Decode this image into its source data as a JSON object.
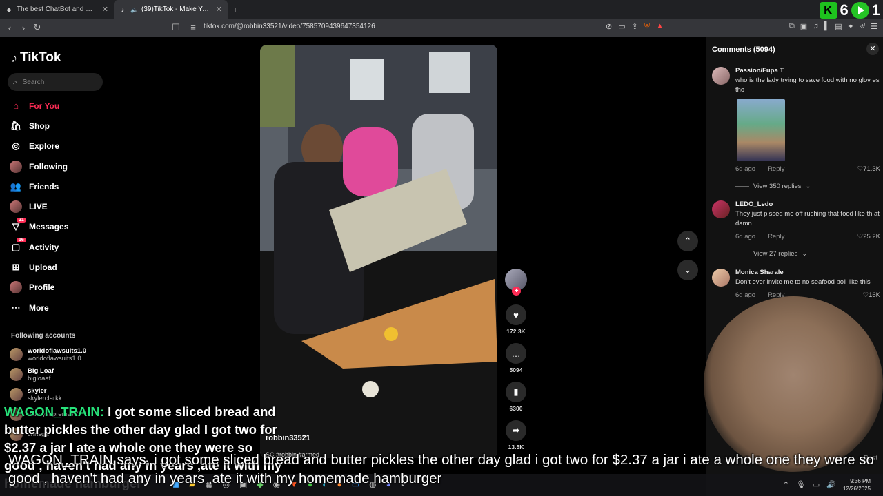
{
  "browser": {
    "tabs": [
      {
        "title": "The best ChatBot and Widgets for Ki",
        "active": false
      },
      {
        "title": "(39)TikTok - Make Your Day",
        "active": true
      }
    ],
    "new_tab": "+",
    "url": "tiktok.com/@robbin33521/video/7585709439647354126"
  },
  "stream_overlay": {
    "counter_left": "6",
    "counter_right": "1"
  },
  "tiktok": {
    "logo": "TikTok",
    "search_placeholder": "Search",
    "nav": [
      {
        "label": "For You",
        "icon": "home-icon",
        "active": true
      },
      {
        "label": "Shop",
        "icon": "shop-icon"
      },
      {
        "label": "Explore",
        "icon": "compass-icon"
      },
      {
        "label": "Following",
        "icon": "following-avatar-icon"
      },
      {
        "label": "Friends",
        "icon": "friends-icon"
      },
      {
        "label": "LIVE",
        "icon": "live-avatar-icon"
      },
      {
        "label": "Messages",
        "icon": "messages-icon",
        "badge": "21"
      },
      {
        "label": "Activity",
        "icon": "activity-icon",
        "badge": "16"
      },
      {
        "label": "Upload",
        "icon": "upload-icon"
      },
      {
        "label": "Profile",
        "icon": "profile-avatar-icon"
      },
      {
        "label": "More",
        "icon": "more-icon"
      }
    ],
    "following_title": "Following accounts",
    "following": [
      {
        "name": "worldoflawsuits1.0",
        "handle": "worldoflawsuits1.0"
      },
      {
        "name": "Big Loaf",
        "handle": "bigloaaf"
      },
      {
        "name": "skyler",
        "handle": "skylerclarkk"
      },
      {
        "name": "",
        "handle": "dannysupreme777"
      },
      {
        "name": "",
        "handle": "chrisga"
      }
    ],
    "video": {
      "username": "robbin33521",
      "description": "SC #robbin #armed"
    },
    "actions": {
      "likes": "172.3K",
      "comments": "5094",
      "saves": "6300",
      "shares": "13.5K"
    }
  },
  "comments_panel": {
    "title": "Comments (5094)",
    "comments": [
      {
        "user": "Passion/Fupa T",
        "text": "who is the lady trying to save food with no glov es tho",
        "time": "6d ago",
        "reply": "Reply",
        "likes": "71.3K",
        "replies": "View 350 replies"
      },
      {
        "user": "LEDO_Ledo",
        "text": "They just pissed me off rushing that food like th at damn",
        "time": "6d ago",
        "reply": "Reply",
        "likes": "25.2K",
        "replies": "View 27 replies"
      },
      {
        "user": "Monica Sharale",
        "text": "Don't ever invite me to no seafood boil like this",
        "time": "6d ago",
        "reply": "Reply",
        "likes": "16K"
      }
    ],
    "post_label": "Post"
  },
  "chat_overlay": {
    "username": "WAGON_TRAIN:",
    "message": "I got some sliced bread and butter pickles the other day glad I got two for $2.37 a jar I ate a whole one they were so good , haven't had any in years ,ate it with my homemade hamburger"
  },
  "tts_caption": "WAGON_TRAIN says, i got some sliced bread and butter pickles the other day glad i got two for $2.37 a jar i ate a whole one they were so good , haven't had any in years ,ate it with my homemade hamburger",
  "taskbar": {
    "time": "9:36 PM",
    "date": "12/26/2025"
  }
}
